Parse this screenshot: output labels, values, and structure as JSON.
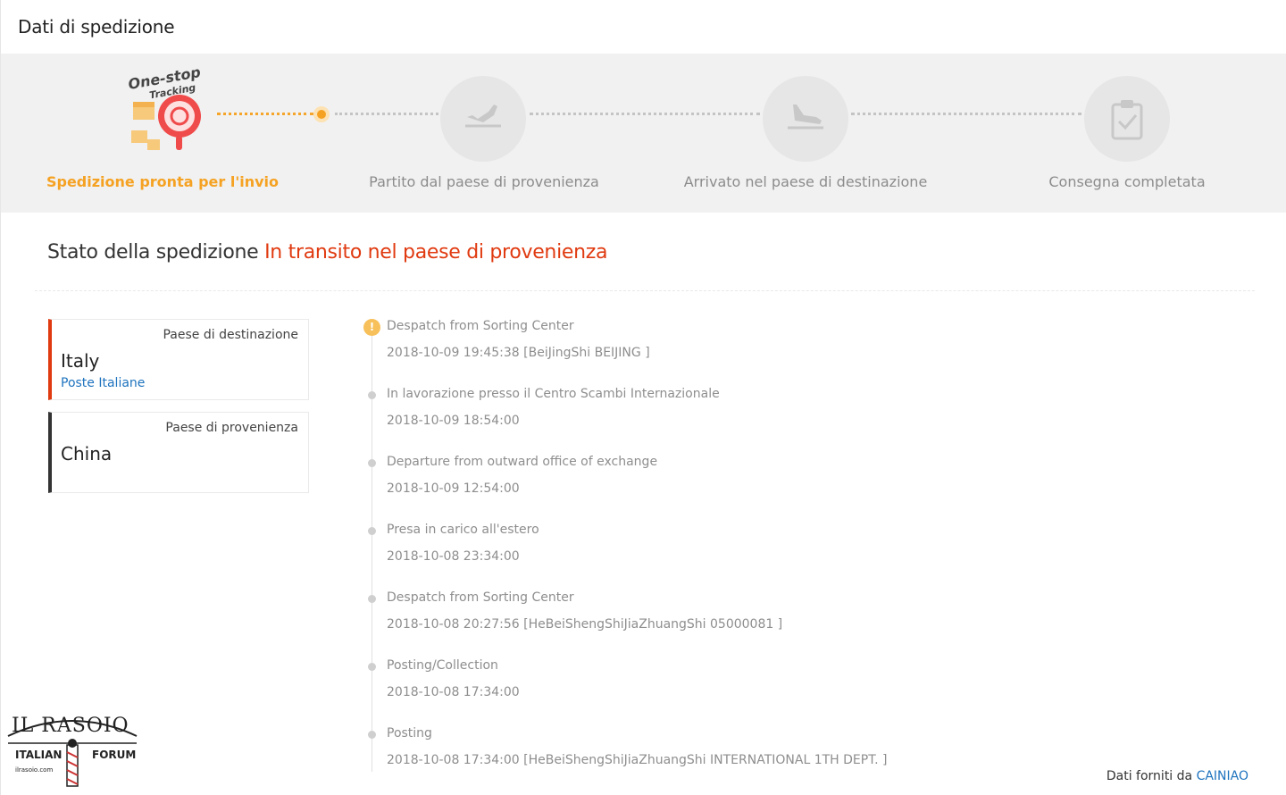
{
  "header": {
    "title": "Dati di spedizione"
  },
  "logo": {
    "line1": "One-stop",
    "line2": "Tracking"
  },
  "steps": [
    {
      "label": "Spedizione pronta per l'invio",
      "icon": "one-stop-tracking-logo",
      "active": true
    },
    {
      "label": "Partito dal paese di provenienza",
      "icon": "plane-takeoff-icon",
      "active": false
    },
    {
      "label": "Arrivato nel paese di destinazione",
      "icon": "plane-landing-icon",
      "active": false
    },
    {
      "label": "Consegna completata",
      "icon": "clipboard-check-icon",
      "active": false
    }
  ],
  "status": {
    "label": "Stato della spedizione",
    "value": "In transito nel paese di provenienza"
  },
  "destination": {
    "label": "Paese di destinazione",
    "country": "Italy",
    "carrier": "Poste Italiane"
  },
  "origin": {
    "label": "Paese di provenienza",
    "country": "China"
  },
  "events": [
    {
      "title": "Despatch from Sorting Center",
      "time": "2018-10-09 19:45:38 [BeiJingShi BEIJING ]"
    },
    {
      "title": "In lavorazione presso il Centro Scambi Internazionale",
      "time": "2018-10-09 18:54:00"
    },
    {
      "title": "Departure from outward office of exchange",
      "time": "2018-10-09 12:54:00"
    },
    {
      "title": "Presa in carico all'estero",
      "time": "2018-10-08 23:34:00"
    },
    {
      "title": "Despatch from Sorting Center",
      "time": "2018-10-08 20:27:56 [HeBeiShengShiJiaZhuangShi 05000081 ]"
    },
    {
      "title": "Posting/Collection",
      "time": "2018-10-08 17:34:00"
    },
    {
      "title": "Posting",
      "time": "2018-10-08 17:34:00 [HeBeiShengShiJiaZhuangShi INTERNATIONAL 1TH DEPT. ]"
    }
  ],
  "first_event_badge": "!",
  "footer": {
    "label": "Dati forniti da",
    "source": "CAINIAO"
  },
  "watermark": {
    "title": "IL RASOIO",
    "left": "ITALIAN",
    "right": "FORUM",
    "site": "ilrasoio.com"
  },
  "colors": {
    "accent": "#f5a223",
    "status": "#e03a10",
    "link": "#1e73be"
  }
}
